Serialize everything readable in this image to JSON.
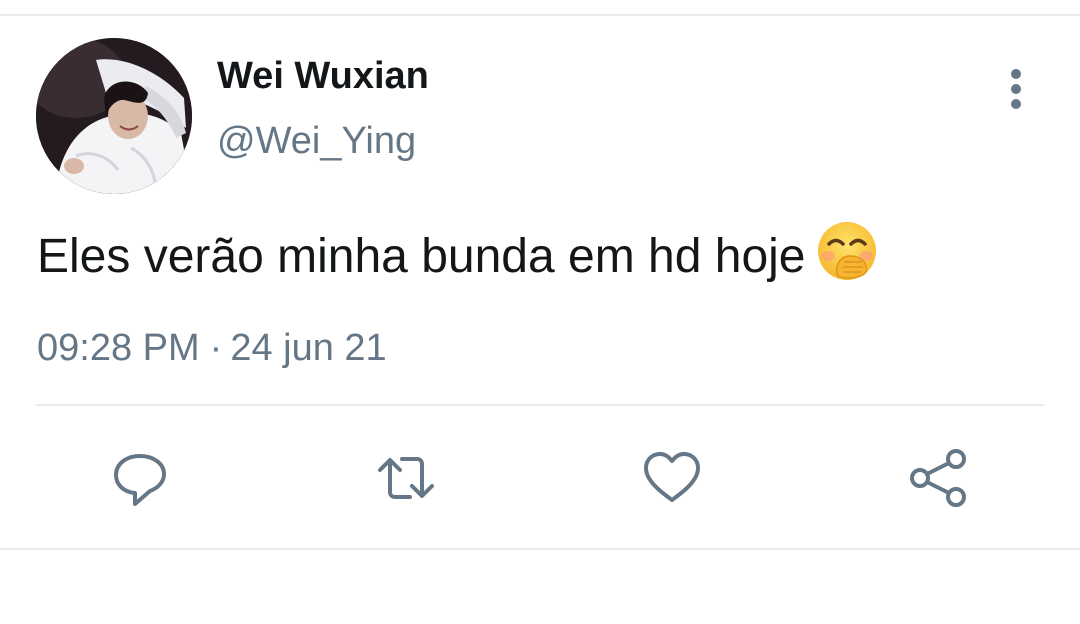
{
  "tweet": {
    "author": {
      "display_name": "Wei Wuxian",
      "handle": "@Wei_Ying",
      "avatar_icon": "profile-photo"
    },
    "text": "Eles verão minha bunda em hd hoje",
    "emoji": "🤭",
    "time": "09:28 PM",
    "separator": "·",
    "date": "24 jun 21"
  },
  "actions": [
    {
      "name": "reply",
      "icon": "reply-icon"
    },
    {
      "name": "retweet",
      "icon": "retweet-icon"
    },
    {
      "name": "like",
      "icon": "heart-icon"
    },
    {
      "name": "share",
      "icon": "share-icon"
    }
  ],
  "colors": {
    "text_primary": "#14171a",
    "text_secondary": "#657786",
    "divider": "#e6ecf0",
    "icon": "#657786"
  }
}
